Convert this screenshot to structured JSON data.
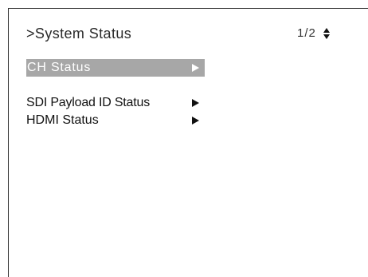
{
  "header": {
    "title": ">System Status",
    "page_indicator": "1/2",
    "scroll_icon": "up-down-arrows-icon"
  },
  "menu": {
    "items": [
      {
        "label": "CH Status",
        "selected": true,
        "icon": "right-arrow-icon"
      },
      {
        "label": "SDI Payload ID Status",
        "selected": false,
        "icon": "right-arrow-icon"
      },
      {
        "label": "HDMI Status",
        "selected": false,
        "icon": "right-arrow-icon"
      }
    ]
  },
  "colors": {
    "background": "#ffffff",
    "highlight": "#a7a7a7",
    "highlight_text": "#ffffff",
    "text": "#111111"
  }
}
